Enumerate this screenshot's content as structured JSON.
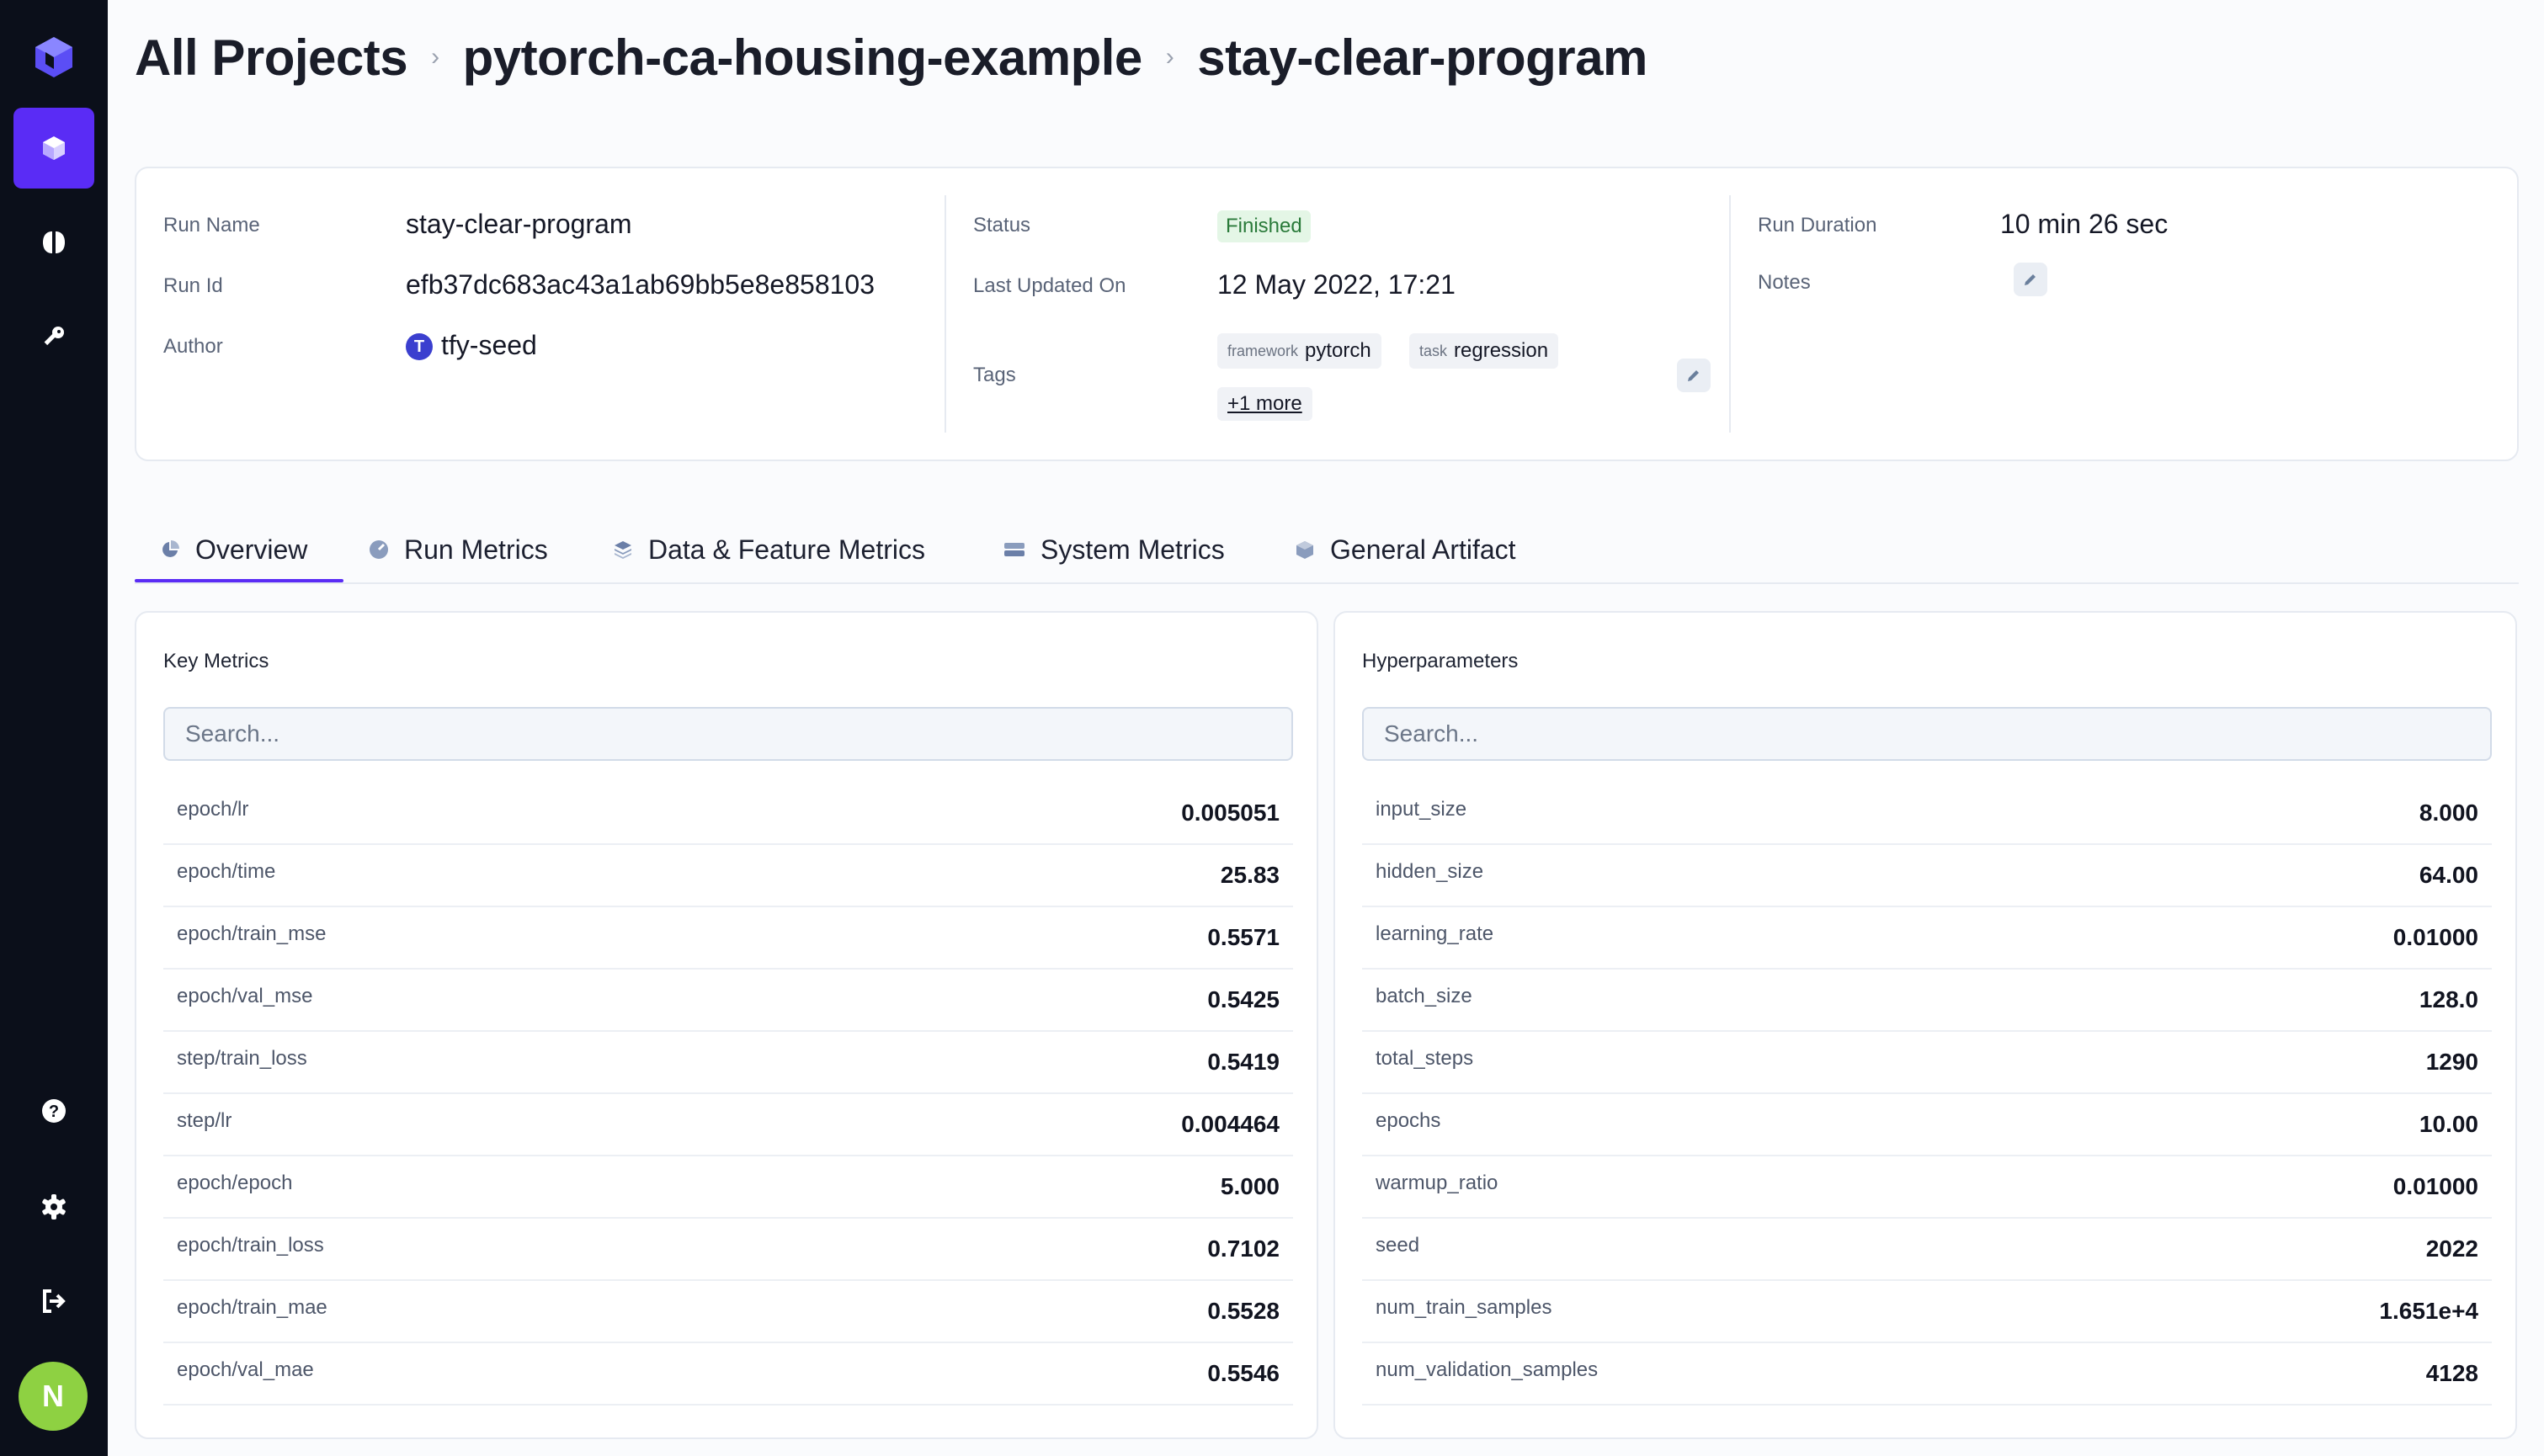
{
  "breadcrumb": [
    "All Projects",
    "pytorch-ca-housing-example",
    "stay-clear-program"
  ],
  "run": {
    "run_name_label": "Run Name",
    "run_name": "stay-clear-program",
    "run_id_label": "Run Id",
    "run_id": "efb37dc683ac43a1ab69bb5e8e858103",
    "author_label": "Author",
    "author_initial": "T",
    "author": "tfy-seed",
    "status_label": "Status",
    "status": "Finished",
    "updated_label": "Last Updated On",
    "updated": "12 May 2022, 17:21",
    "tags_label": "Tags",
    "tags": [
      {
        "key": "framework",
        "value": "pytorch"
      },
      {
        "key": "task",
        "value": "regression"
      }
    ],
    "more_tags": "+1 more",
    "duration_label": "Run Duration",
    "duration": "10 min 26 sec",
    "notes_label": "Notes"
  },
  "tabs": [
    "Overview",
    "Run Metrics",
    "Data & Feature Metrics",
    "System Metrics",
    "General Artifact"
  ],
  "key_metrics": {
    "title": "Key Metrics",
    "search_placeholder": "Search...",
    "rows": [
      {
        "key": "epoch/lr",
        "value": "0.005051"
      },
      {
        "key": "epoch/time",
        "value": "25.83"
      },
      {
        "key": "epoch/train_mse",
        "value": "0.5571"
      },
      {
        "key": "epoch/val_mse",
        "value": "0.5425"
      },
      {
        "key": "step/train_loss",
        "value": "0.5419"
      },
      {
        "key": "step/lr",
        "value": "0.004464"
      },
      {
        "key": "epoch/epoch",
        "value": "5.000"
      },
      {
        "key": "epoch/train_loss",
        "value": "0.7102"
      },
      {
        "key": "epoch/train_mae",
        "value": "0.5528"
      },
      {
        "key": "epoch/val_mae",
        "value": "0.5546"
      }
    ]
  },
  "hyperparameters": {
    "title": "Hyperparameters",
    "search_placeholder": "Search...",
    "rows": [
      {
        "key": "input_size",
        "value": "8.000"
      },
      {
        "key": "hidden_size",
        "value": "64.00"
      },
      {
        "key": "learning_rate",
        "value": "0.01000"
      },
      {
        "key": "batch_size",
        "value": "128.0"
      },
      {
        "key": "total_steps",
        "value": "1290"
      },
      {
        "key": "epochs",
        "value": "10.00"
      },
      {
        "key": "warmup_ratio",
        "value": "0.01000"
      },
      {
        "key": "seed",
        "value": "2022"
      },
      {
        "key": "num_train_samples",
        "value": "1.651e+4"
      },
      {
        "key": "num_validation_samples",
        "value": "4128"
      }
    ]
  },
  "user": {
    "initial": "N"
  },
  "colors": {
    "accent": "#5a2cf5",
    "sidebar": "#0b0f1a",
    "status_bg": "#e4f6e6",
    "status_text": "#2a7a3a",
    "avatar": "#8ed142"
  }
}
